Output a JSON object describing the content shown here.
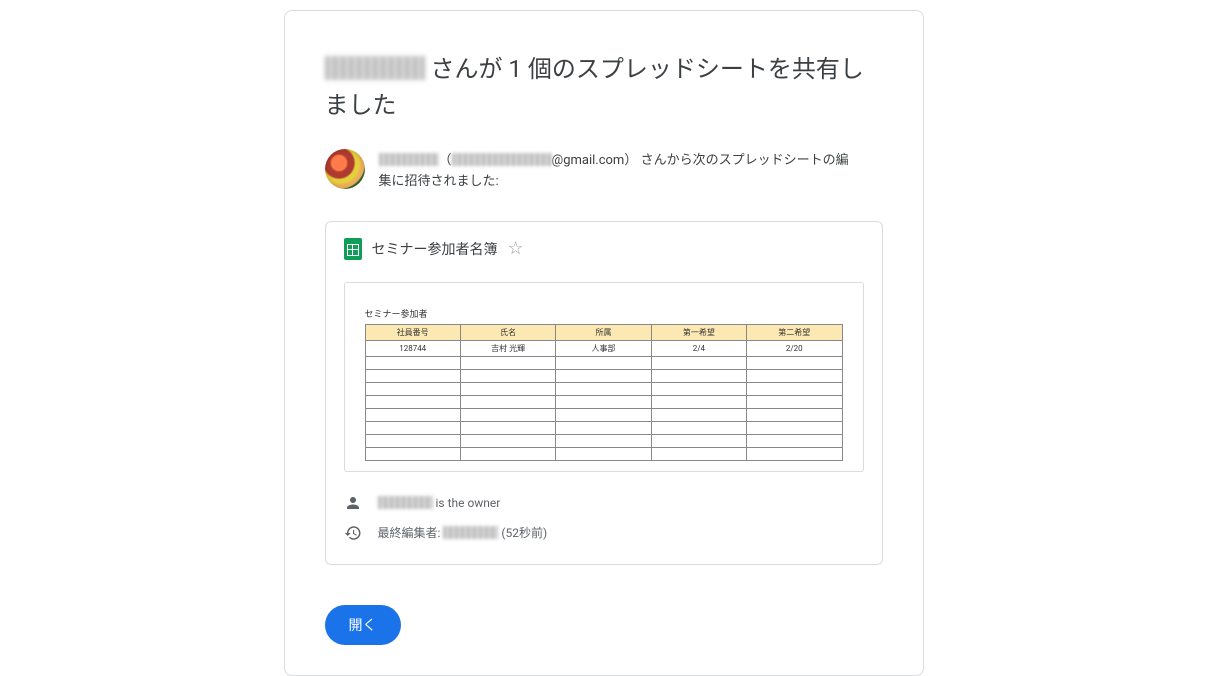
{
  "heading": {
    "name_redacted": true,
    "suffix": " さんが 1 個のスプレッドシートを共有しました"
  },
  "inviter": {
    "name_redacted": true,
    "email_local_redacted": true,
    "email_domain": "@gmail.com",
    "line1_suffix": "） さんから次のスプレッドシートの編",
    "line2_prefix": "集",
    "line2_suffix": "に招待されました:"
  },
  "file": {
    "name": "セミナー参加者名簿"
  },
  "preview": {
    "sheet_title": "セミナー参加者",
    "headers": [
      "社員番号",
      "氏名",
      "所属",
      "第一希望",
      "第二希望"
    ],
    "rows": [
      [
        "128744",
        "吉村 光輝",
        "人事部",
        "2/4",
        "2/20"
      ]
    ],
    "empty_rows": 8
  },
  "meta": {
    "owner_suffix": " is the owner",
    "last_edit_prefix": "最終編集者: ",
    "last_edit_time": "(52秒前)"
  },
  "actions": {
    "open": "開く"
  }
}
